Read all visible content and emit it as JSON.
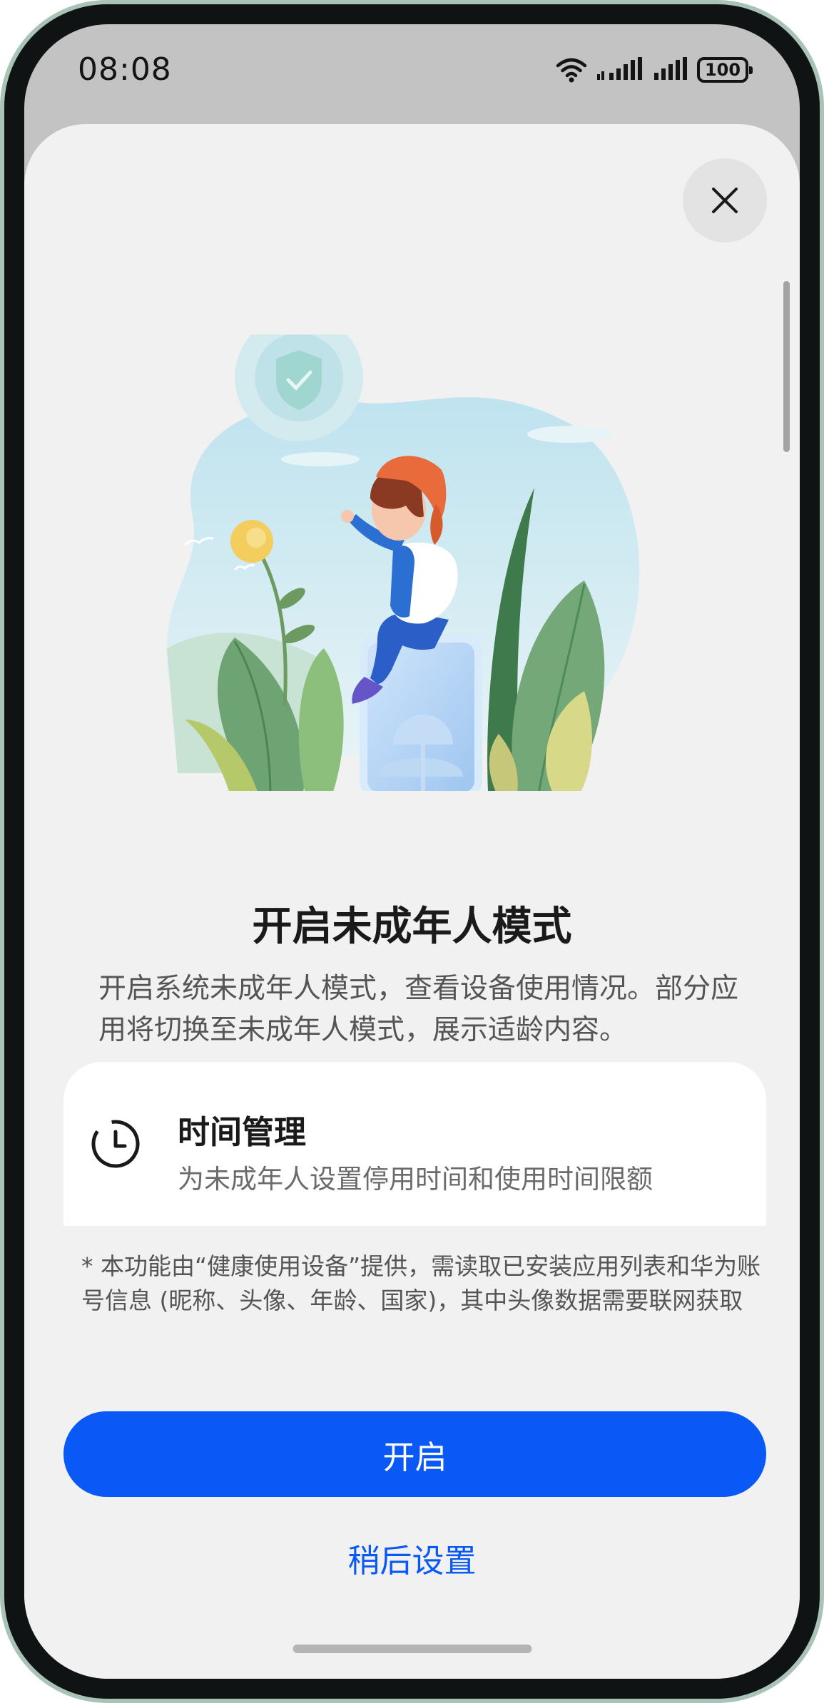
{
  "status_bar": {
    "time": "08:08",
    "battery": "100",
    "icons": [
      "wifi-icon",
      "signal-icon",
      "signal-icon",
      "battery-icon"
    ]
  },
  "dialog": {
    "close_icon": "close-icon",
    "title": "开启未成年人模式",
    "description": "开启系统未成年人模式，查看设备使用情况。部分应用将切换至未成年人模式，展示适龄内容。",
    "features": [
      {
        "icon": "clock-icon",
        "title": "时间管理",
        "description": "为未成年人设置停用时间和使用时间限额"
      }
    ],
    "notice": "* 本功能由“健康使用设备”提供，需读取已安装应用列表和华为账号信息 (昵称、头像、年龄、国家)，其中头像数据需要联网获取",
    "primary_button": "开启",
    "secondary_button": "稍后设置"
  },
  "colors": {
    "accent": "#0a59f7",
    "sheet_background": "#f1f1f1",
    "card_background": "#ffffff",
    "title_text": "#1a1a1a",
    "body_text": "#555555"
  }
}
